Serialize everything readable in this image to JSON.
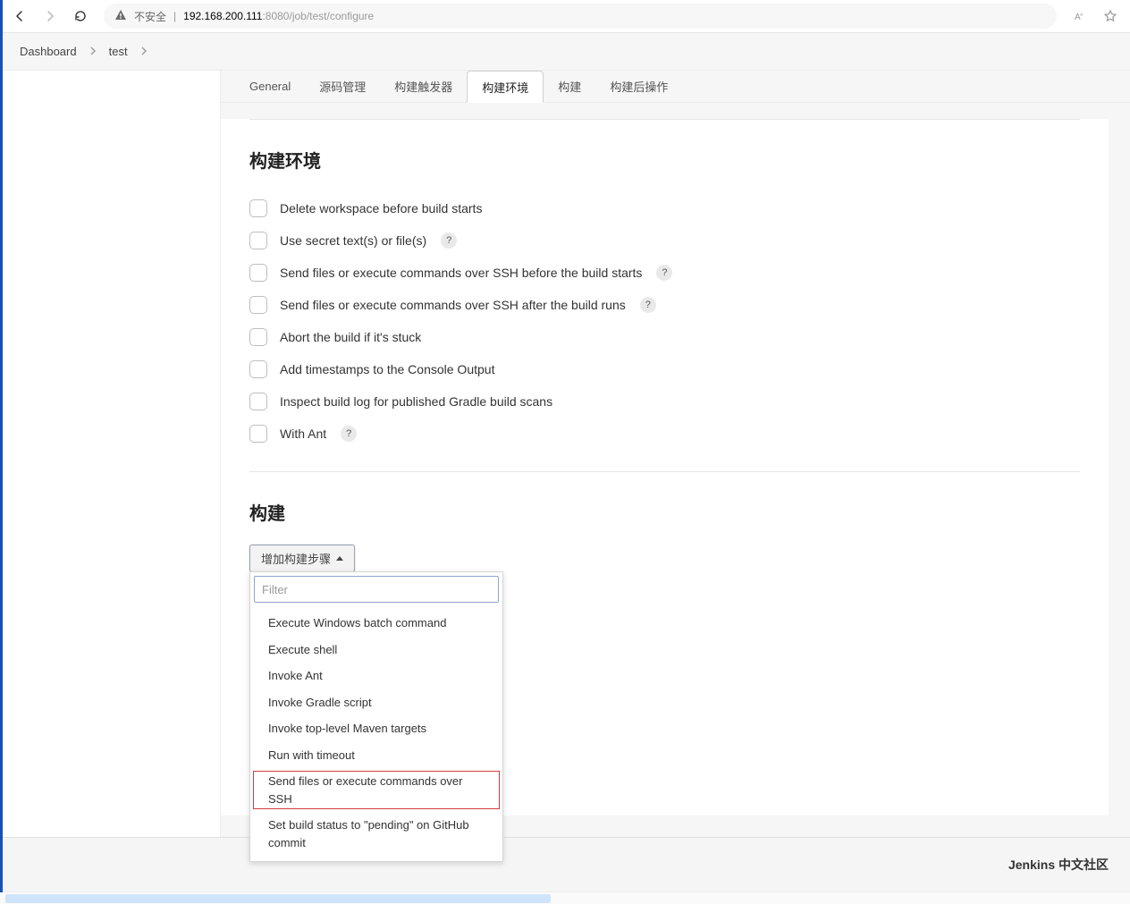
{
  "browser": {
    "security_label": "不安全",
    "url_host": "192.168.200.111",
    "url_port": ":8080",
    "url_path": "/job/test/configure"
  },
  "breadcrumb": {
    "items": [
      "Dashboard",
      "test"
    ]
  },
  "tabs": {
    "items": [
      {
        "label": "General",
        "active": false
      },
      {
        "label": "源码管理",
        "active": false
      },
      {
        "label": "构建触发器",
        "active": false
      },
      {
        "label": "构建环境",
        "active": true
      },
      {
        "label": "构建",
        "active": false
      },
      {
        "label": "构建后操作",
        "active": false
      }
    ]
  },
  "build_env": {
    "title": "构建环境",
    "options": [
      {
        "label": "Delete workspace before build starts",
        "help": false
      },
      {
        "label": "Use secret text(s) or file(s)",
        "help": true
      },
      {
        "label": "Send files or execute commands over SSH before the build starts",
        "help": true
      },
      {
        "label": "Send files or execute commands over SSH after the build runs",
        "help": true
      },
      {
        "label": "Abort the build if it's stuck",
        "help": false
      },
      {
        "label": "Add timestamps to the Console Output",
        "help": false
      },
      {
        "label": "Inspect build log for published Gradle build scans",
        "help": false
      },
      {
        "label": "With Ant",
        "help": true
      }
    ]
  },
  "build": {
    "title": "构建",
    "dropdown_label": "增加构建步骤",
    "filter_placeholder": "Filter",
    "menu": [
      {
        "label": "Execute Windows batch command",
        "highlight": false
      },
      {
        "label": "Execute shell",
        "highlight": false
      },
      {
        "label": "Invoke Ant",
        "highlight": false
      },
      {
        "label": "Invoke Gradle script",
        "highlight": false
      },
      {
        "label": "Invoke top-level Maven targets",
        "highlight": false
      },
      {
        "label": "Run with timeout",
        "highlight": false
      },
      {
        "label": "Send files or execute commands over SSH",
        "highlight": true
      },
      {
        "label": "Set build status to \"pending\" on GitHub commit",
        "highlight": false
      }
    ]
  },
  "footer": {
    "text": "Jenkins 中文社区"
  },
  "help_glyph": "?"
}
